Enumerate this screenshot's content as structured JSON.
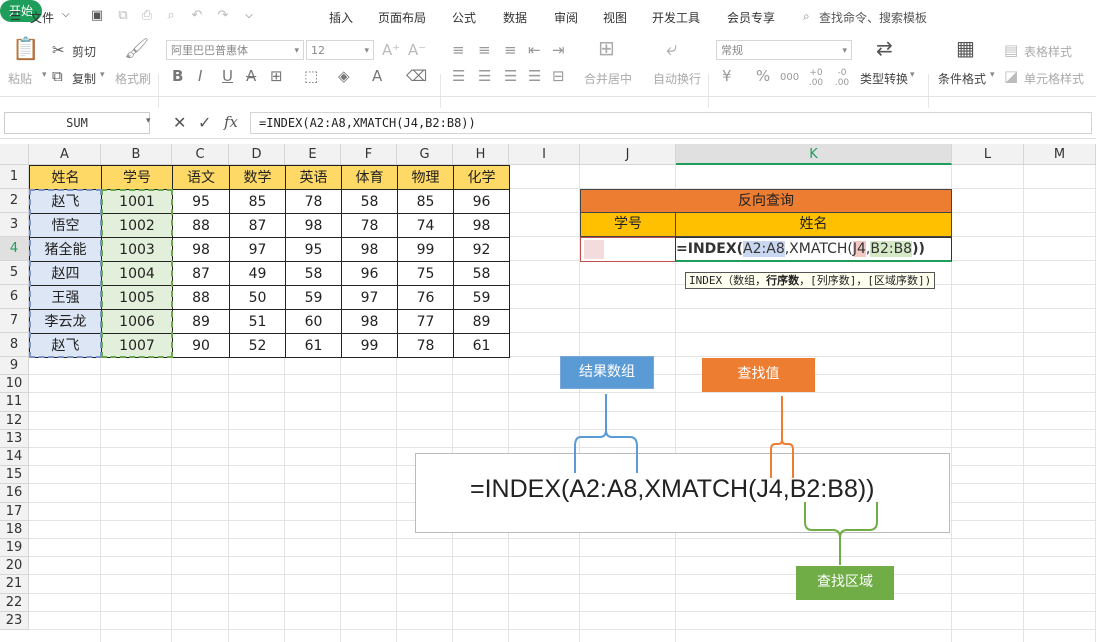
{
  "menubar": {
    "file": "文件",
    "tabs": [
      "开始",
      "插入",
      "页面布局",
      "公式",
      "数据",
      "审阅",
      "视图",
      "开发工具",
      "会员专享"
    ],
    "search": "查找命令、搜索模板"
  },
  "ribbon": {
    "paste": "粘贴",
    "cut": "剪切",
    "copy": "复制",
    "format_painter": "格式刷",
    "font_name": "阿里巴巴普惠体",
    "font_size": "12",
    "bold": "B",
    "italic": "I",
    "underline": "U",
    "strike": "A",
    "merge_center": "合并居中",
    "wrap_text": "自动换行",
    "number_format": "常规",
    "currency": "¥",
    "percent": "%",
    "thousands": "000",
    "dec_inc": "+0 .00",
    "dec_dec": "-0 .00",
    "type_convert": "类型转换",
    "conditional_format": "条件格式",
    "table_style": "表格样式",
    "cell_style": "单元格样式"
  },
  "formula_bar": {
    "name_box": "SUM",
    "fx": "fx",
    "formula": "=INDEX(A2:A8,XMATCH(J4,B2:B8))"
  },
  "columns": [
    "A",
    "B",
    "C",
    "D",
    "E",
    "F",
    "G",
    "H",
    "I",
    "J",
    "K",
    "L",
    "M"
  ],
  "rows": [
    "1",
    "2",
    "3",
    "4",
    "5",
    "6",
    "7",
    "8",
    "9",
    "10",
    "11",
    "12",
    "13",
    "14",
    "15",
    "16",
    "17",
    "18",
    "19",
    "20",
    "21",
    "22",
    "23"
  ],
  "table": {
    "headers": [
      "姓名",
      "学号",
      "语文",
      "数学",
      "英语",
      "体育",
      "物理",
      "化学"
    ],
    "rows": [
      [
        "赵飞",
        "1001",
        "95",
        "85",
        "78",
        "58",
        "85",
        "96"
      ],
      [
        "悟空",
        "1002",
        "88",
        "87",
        "98",
        "78",
        "74",
        "98"
      ],
      [
        "猪全能",
        "1003",
        "98",
        "97",
        "95",
        "98",
        "99",
        "92"
      ],
      [
        "赵四",
        "1004",
        "87",
        "49",
        "58",
        "96",
        "75",
        "58"
      ],
      [
        "王强",
        "1005",
        "88",
        "50",
        "59",
        "97",
        "76",
        "59"
      ],
      [
        "李云龙",
        "1006",
        "89",
        "51",
        "60",
        "98",
        "77",
        "89"
      ],
      [
        "赵飞",
        "1007",
        "90",
        "52",
        "61",
        "99",
        "78",
        "61"
      ]
    ]
  },
  "lookup": {
    "title": "反向查询",
    "col_id": "学号",
    "col_name": "姓名",
    "f_prefix": "=INDEX(",
    "f_arg1": "A2:A8",
    "f_mid": ",XMATCH(",
    "f_arg2": "J4",
    "f_comma": ",",
    "f_arg3": "B2:B8",
    "f_suffix": "))",
    "tooltip_fn": "INDEX",
    "tooltip_args_pre": "（数组，",
    "tooltip_bold": "行序数",
    "tooltip_args_post": "，[列序数]，[区域序数])"
  },
  "diagram": {
    "formula": "=INDEX(A2:A8,XMATCH(J4,B2:B8))",
    "label_result": "结果数组",
    "label_lookup": "查找值",
    "label_range": "查找区域",
    "colors": {
      "blue": "#5b9bd5",
      "orange": "#ed7d31",
      "green": "#70ad47"
    }
  },
  "colors": {
    "accent": "#1e9e5a",
    "header_fill": "#ffd966",
    "title_fill": "#ed7d31",
    "subheader_fill": "#ffc000"
  }
}
